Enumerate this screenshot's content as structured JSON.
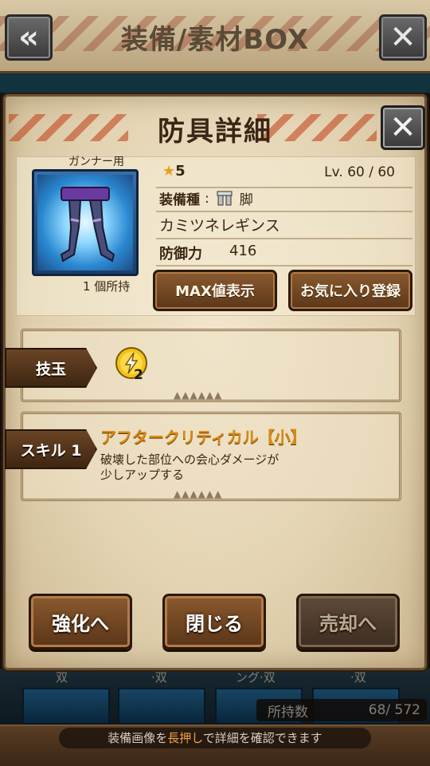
{
  "background": {
    "title": "装備/素材BOX",
    "back_icon": "double-chevron-left-icon",
    "close_icon": "close-x-icon",
    "partial_labels": [
      "双",
      "·双",
      "ング·双",
      "·双"
    ],
    "owned_count_label": "所持数",
    "owned_count_value": "68/ 572",
    "hint_prefix": "装備画像を",
    "hint_emphasis": "長押し",
    "hint_suffix": "で詳細を確認できます"
  },
  "modal": {
    "title": "防具詳細",
    "close_icon": "close-x-icon",
    "user_tag": "ガンナー用",
    "item_icon": "leg-armor-icon",
    "owned": "1 個所持",
    "rarity_star": "★",
    "rarity_value": "5",
    "level": "Lv.  60 / 60",
    "equip_type_label": "装備種",
    "equip_type_sep": ":",
    "equip_type_value": "脚",
    "item_name": "カミツネレギンス",
    "defense_label": "防御力",
    "defense_value": "416",
    "max_button": "MAX値表示",
    "favorite_button": "お気に入り登録",
    "gem_tag": "技玉",
    "gem_icon": "lightning-gem-icon",
    "gem_count": "2",
    "gem_triangles": "▲▲▲▲▲▲",
    "skill_tag": "スキル 1",
    "skill_name": "アフタークリティカル【小】",
    "skill_desc_line1": "破壊した部位への会心ダメージが",
    "skill_desc_line2": "少しアップする",
    "skill_triangles": "▲▲▲▲▲▲",
    "enhance_button": "強化へ",
    "close_button": "閉じる",
    "sell_button": "売却へ"
  },
  "colors": {
    "accent_orange": "#d98a10",
    "button_brown": "#8a5a30",
    "gem_yellow": "#f2c21a"
  }
}
